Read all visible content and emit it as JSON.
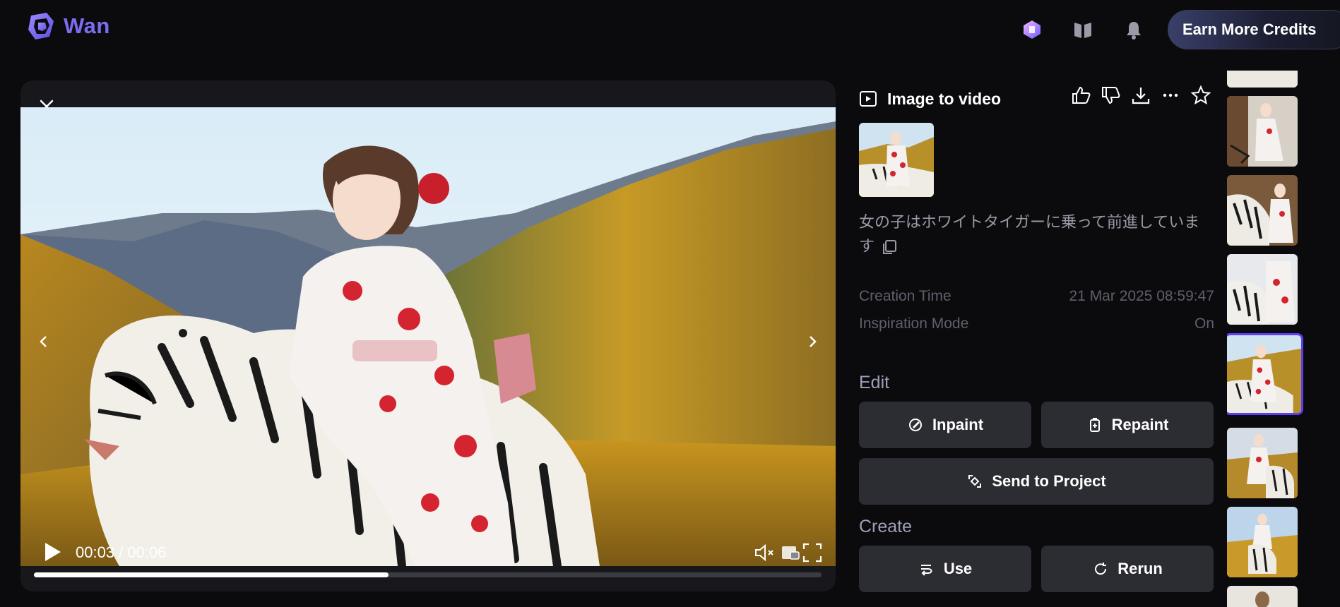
{
  "app": {
    "name": "Wan"
  },
  "header": {
    "earn_credits_label": "Earn More Credits"
  },
  "player": {
    "time_display": "00:03 / 00:06",
    "progress": 0.45
  },
  "details": {
    "mode_title": "Image to video",
    "prompt": "女の子はホワイトタイガーに乗って前進しています",
    "meta": [
      {
        "label": "Creation Time",
        "value": "21 Mar 2025 08:59:47"
      },
      {
        "label": "Inspiration Mode",
        "value": "On"
      }
    ],
    "edit": {
      "heading": "Edit",
      "inpaint_label": "Inpaint",
      "repaint_label": "Repaint",
      "send_label": "Send to Project"
    },
    "create": {
      "heading": "Create",
      "use_label": "Use",
      "rerun_label": "Rerun"
    }
  },
  "icons": [
    "wan-logo-icon",
    "inspiration-icon",
    "library-icon",
    "bell-icon",
    "close-icon",
    "chevron-left-icon",
    "chevron-right-icon",
    "play-icon",
    "mute-icon",
    "pip-icon",
    "fullscreen-icon",
    "video-mode-icon",
    "thumbs-up-icon",
    "thumbs-down-icon",
    "download-icon",
    "more-icon",
    "star-icon",
    "copy-icon",
    "inpaint-icon",
    "repaint-icon",
    "send-icon",
    "use-icon",
    "rerun-icon"
  ],
  "colors": {
    "accent": "#5b3df5",
    "logo": "#7b6cf0",
    "background": "#0b0b0d",
    "panel": "#18181c",
    "button": "#2c2c33"
  },
  "rail": {
    "selected_index": 4,
    "thumbnail_count": 7
  }
}
